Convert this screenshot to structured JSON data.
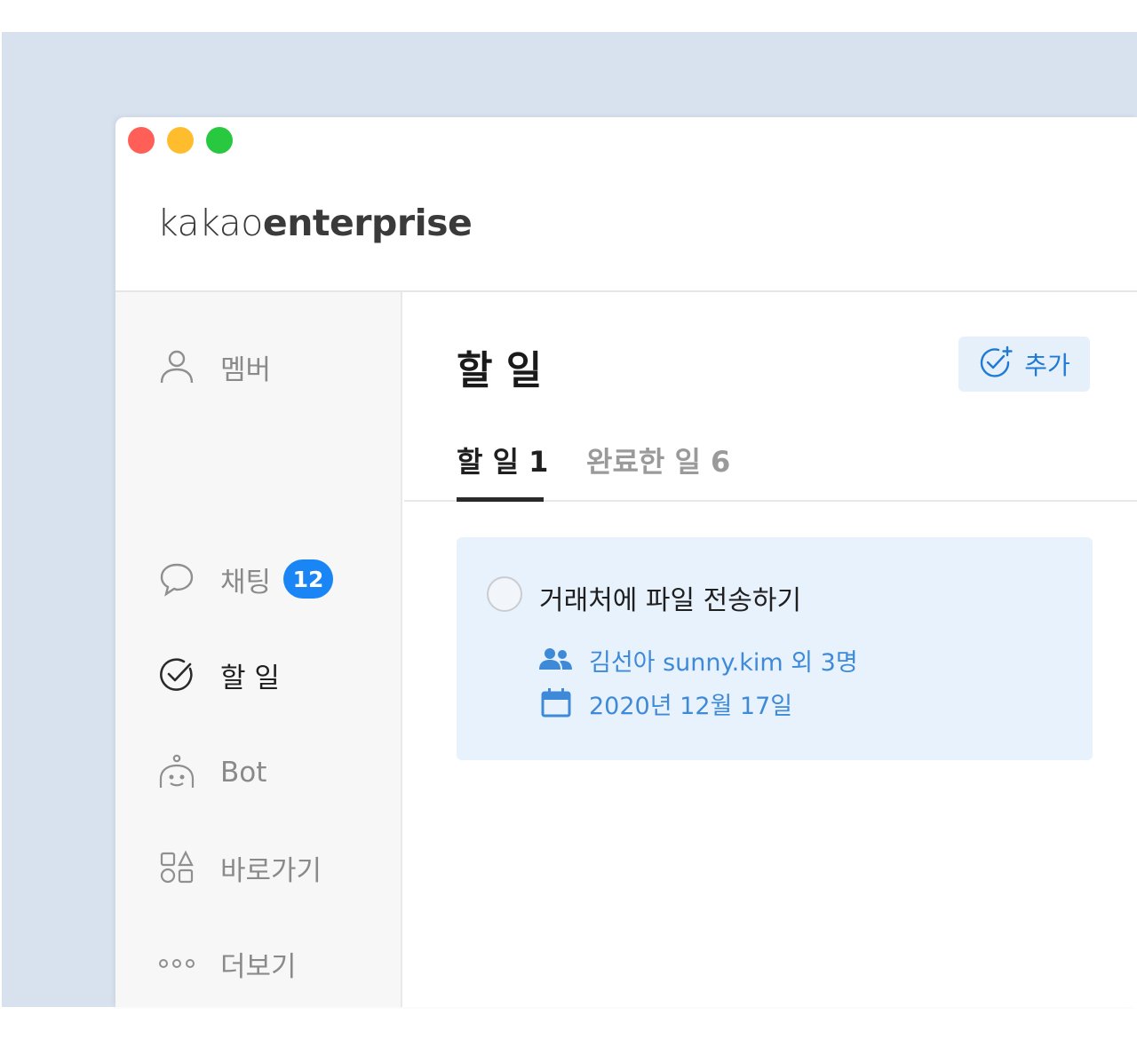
{
  "window": {
    "brand": {
      "part1": "kakao",
      "part2": "enterprise"
    }
  },
  "sidebar": {
    "items": [
      {
        "label": "멤버",
        "icon": "person-icon"
      },
      {
        "label": "채팅",
        "icon": "chat-bubble-icon",
        "badge": "12"
      },
      {
        "label": "할 일",
        "icon": "check-circle-icon",
        "active": true
      },
      {
        "label": "Bot",
        "icon": "bot-icon"
      },
      {
        "label": "바로가기",
        "icon": "shortcuts-icon"
      },
      {
        "label": "더보기",
        "icon": "more-icon"
      }
    ]
  },
  "main": {
    "title": "할 일",
    "add_button": {
      "label": "추가",
      "icon": "check-circle-plus-icon"
    },
    "tabs": [
      {
        "label": "할 일 1",
        "active": true
      },
      {
        "label": "완료한 일 6",
        "active": false
      }
    ],
    "tasks": [
      {
        "title": "거래처에 파일 전송하기",
        "assignees": "김선아 sunny.kim 외 3명",
        "due_date": "2020년 12월 17일"
      }
    ]
  },
  "colors": {
    "accent": "#1a86f5",
    "card_bg": "#e8f2fd",
    "meta_text": "#3e8ad8",
    "page_bg": "#d8e2ef"
  }
}
